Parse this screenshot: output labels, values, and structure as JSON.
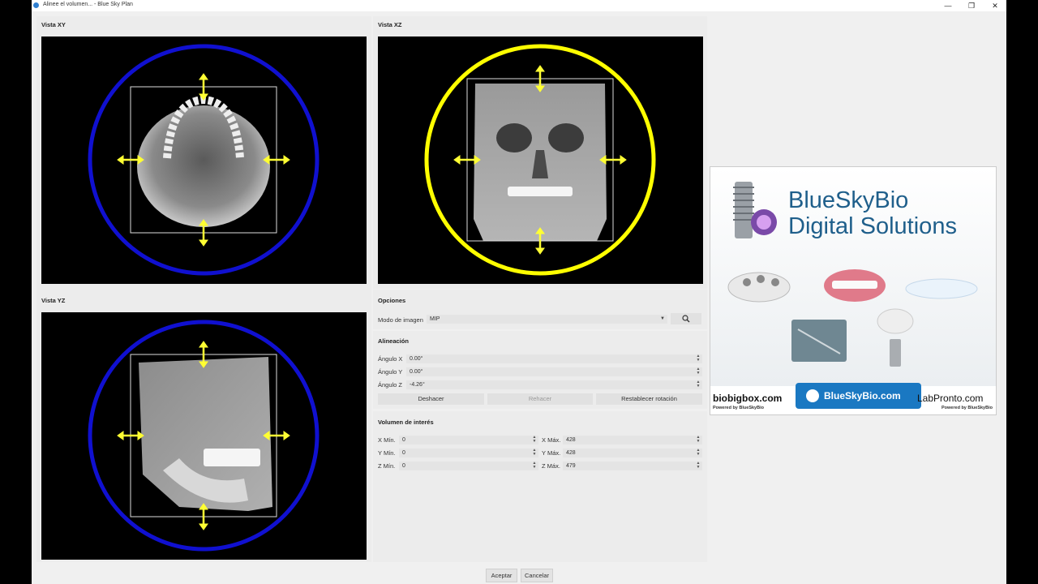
{
  "window": {
    "title": "Alinee el volumen... - Blue Sky Plan",
    "minimize_glyph": "—",
    "restore_glyph": "❐",
    "close_glyph": "✕"
  },
  "views": {
    "xy_label": "Vista XY",
    "xz_label": "Vista XZ",
    "yz_label": "Vista YZ"
  },
  "options": {
    "title": "Opciones",
    "image_mode_label": "Modo de imagen",
    "image_mode_value": "MIP",
    "search_icon": "magnifier-icon"
  },
  "alignment": {
    "title": "Alineación",
    "angle_x_label": "Ángulo X",
    "angle_x_value": "0.00°",
    "angle_y_label": "Ángulo Y",
    "angle_y_value": "0.00°",
    "angle_z_label": "Ángulo Z",
    "angle_z_value": "-4.26°",
    "undo_label": "Deshacer",
    "redo_label": "Rehacer",
    "reset_label": "Restablecer rotación"
  },
  "volume": {
    "title": "Volumen de interés",
    "x_min_label": "X Mín.",
    "x_min_value": "0",
    "x_max_label": "X Máx.",
    "x_max_value": "428",
    "y_min_label": "Y Mín.",
    "y_min_value": "0",
    "y_max_label": "Y Máx.",
    "y_max_value": "428",
    "z_min_label": "Z Mín.",
    "z_min_value": "0",
    "z_max_label": "Z Máx.",
    "z_max_value": "479"
  },
  "ad": {
    "brand_line1": "BlueSkyBio",
    "brand_line2": "Digital Solutions",
    "left_site": "biobigbox.com",
    "center_site": "BlueSkyBio.com",
    "right_site": "LabPronto.com",
    "powered_left": "Powered by BlueSkyBio",
    "powered_right": "Powered by BlueSkyBio"
  },
  "footer": {
    "accept_label": "Aceptar",
    "cancel_label": "Cancelar"
  },
  "colors": {
    "xy_circle": "#1010d0",
    "xz_circle": "#ffff00",
    "yz_circle": "#1010d0",
    "arrow": "#ffff33",
    "brand_blue": "#1f5f8b"
  }
}
